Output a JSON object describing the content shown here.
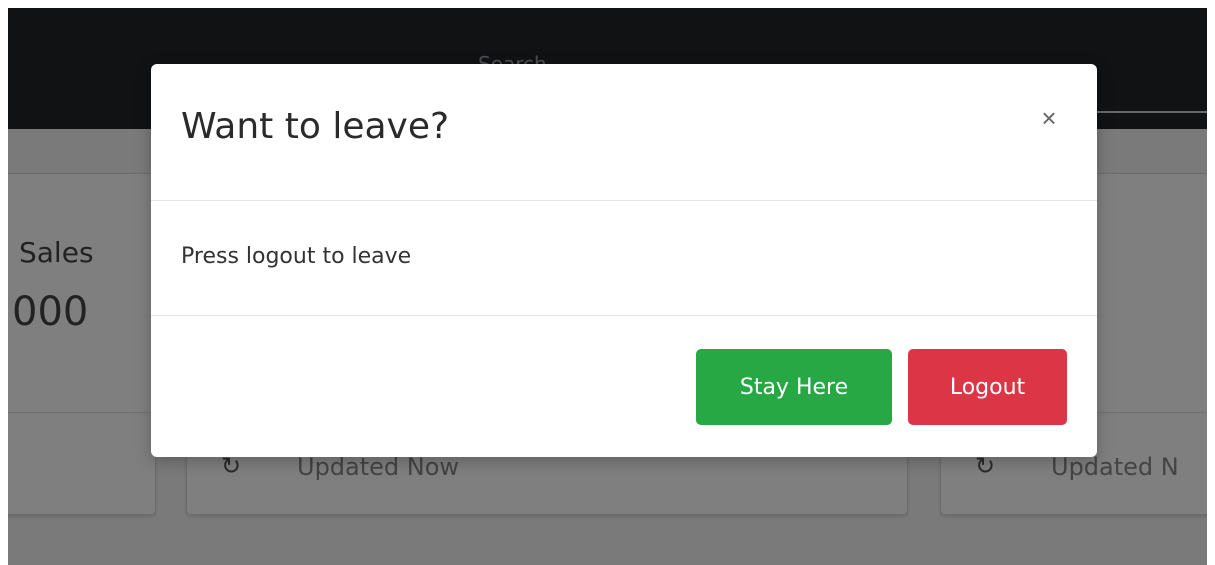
{
  "background": {
    "search_placeholder": "Search",
    "cards": [
      {
        "title": "Sales",
        "value": "000"
      },
      {
        "footer_text": "Updated Now"
      },
      {
        "footer_text": "Updated N"
      }
    ],
    "footer_icon": "refresh-icon"
  },
  "modal": {
    "title": "Want to leave?",
    "close_label": "×",
    "body_text": "Press logout to leave",
    "buttons": {
      "stay_label": "Stay Here",
      "logout_label": "Logout"
    }
  },
  "colors": {
    "topbar": "#212529",
    "success": "#28a745",
    "danger": "#dc3545"
  }
}
